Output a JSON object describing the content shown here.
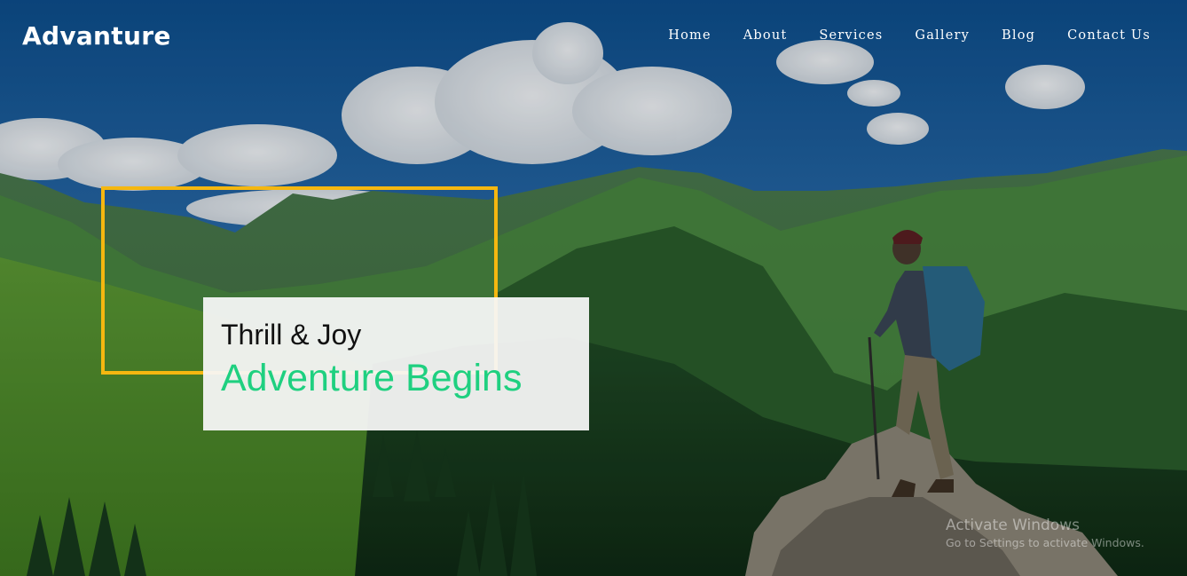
{
  "brand": {
    "logo_text": "Advanture"
  },
  "nav": {
    "items": [
      {
        "label": "Home"
      },
      {
        "label": "About"
      },
      {
        "label": "Services"
      },
      {
        "label": "Gallery"
      },
      {
        "label": "Blog"
      },
      {
        "label": "Contact Us"
      }
    ]
  },
  "hero": {
    "subtitle": "Thrill & Joy",
    "title": "Adventure Begins",
    "background": "mountain-hiker-photo"
  },
  "watermark": {
    "title": "Activate Windows",
    "subtitle": "Go to Settings to activate Windows."
  },
  "colors": {
    "frame_accent": "#f5b710",
    "title_accent": "#1fd080",
    "caption_bg": "#f6f6f6",
    "text_light": "#ffffff"
  }
}
